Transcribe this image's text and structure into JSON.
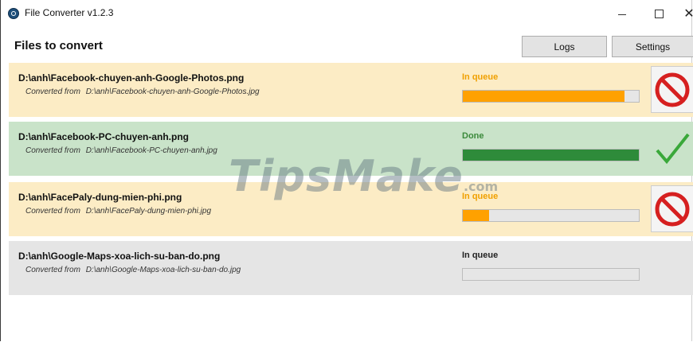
{
  "window": {
    "title": "File Converter v1.2.3",
    "minimize_glyph": "",
    "close_glyph": "✕"
  },
  "header": {
    "title": "Files to convert",
    "logs_label": "Logs",
    "settings_label": "Settings"
  },
  "colors": {
    "queue_bg": "#fcecc5",
    "done_bg": "#c9e3c9",
    "pending_bg": "#e5e5e5",
    "queue_text": "#f0a000",
    "done_text": "#3c8a3c",
    "progress_orange": "#ffa100",
    "progress_green": "#2e8b3a",
    "cancel_red": "#d62020",
    "check_green": "#3aa83a"
  },
  "files": [
    {
      "name": "D:\\anh\\Facebook-chuyen-anh-Google-Photos.png",
      "source_prefix": "Converted from",
      "source": "D:\\anh\\Facebook-chuyen-anh-Google-Photos.jpg",
      "status": "In queue",
      "progress": 0.92,
      "action_icon": "cancel-icon"
    },
    {
      "name": "D:\\anh\\Facebook-PC-chuyen-anh.png",
      "source_prefix": "Converted from",
      "source": "D:\\anh\\Facebook-PC-chuyen-anh.jpg",
      "status": "Done",
      "progress": 1.0,
      "action_icon": "checkmark-icon"
    },
    {
      "name": "D:\\anh\\FacePaly-dung-mien-phi.png",
      "source_prefix": "Converted from",
      "source": "D:\\anh\\FacePaly-dung-mien-phi.jpg",
      "status": "In queue",
      "progress": 0.15,
      "action_icon": "cancel-icon"
    },
    {
      "name": "D:\\anh\\Google-Maps-xoa-lich-su-ban-do.png",
      "source_prefix": "Converted from",
      "source": "D:\\anh\\Google-Maps-xoa-lich-su-ban-do.jpg",
      "status": "In queue",
      "progress": 0.0,
      "action_icon": ""
    }
  ],
  "watermark": {
    "text": "TipsMake",
    "suffix": ".com"
  }
}
